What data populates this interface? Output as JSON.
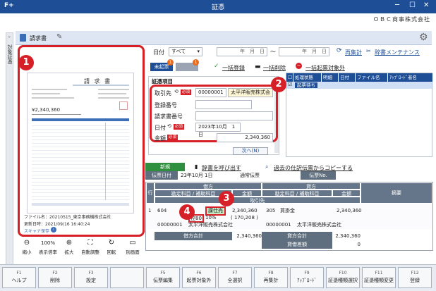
{
  "window": {
    "title": "証憑",
    "company": "ＯＢＣ商事株式会社",
    "app_icon_text": "F+"
  },
  "side_tab": "対象証憑",
  "doc_tab": {
    "label": "請求書"
  },
  "preview": {
    "invoice_title": "請 求 書",
    "invoice_amount": "¥2,340,360",
    "file_name": "ファイル名：20210515_東京事務機株式会社",
    "updated": "更新日時：2021/09/16 16:40:24",
    "scan_source": "スキャナ保存"
  },
  "zoom": {
    "value": "100%",
    "buttons": [
      "縮小",
      "表示倍率",
      "拡大",
      "自動調整",
      "回転",
      "別画面"
    ]
  },
  "filter": {
    "date_label": "日付",
    "date_range": "すべて",
    "date_placeholder": "年　月　日",
    "tilde": "～",
    "recalc": "再集計",
    "dict_maint": "辞書メンテナンス"
  },
  "status_tabs": {
    "unregistered": "未起票",
    "unregistered_count": "1",
    "other_count": "1",
    "bulk_register": "一括登録",
    "bulk_delete": "一括削除",
    "bulk_exclude": "一括起票対象外"
  },
  "voucher_items": {
    "heading": "証憑項目",
    "partner_label": "取引先",
    "partner_code": "00000001",
    "partner_name": "太平洋販売株式会",
    "reg_no_label": "登録番号",
    "invoice_no_label": "請求書番号",
    "date_label": "日付",
    "date_value": "2023年10月　1日",
    "amount_label": "金額",
    "amount_value": "2,340,360",
    "required": "必須",
    "next": "次へ(N)"
  },
  "grid": {
    "headers": [
      "処理状態",
      "明細",
      "日付",
      "ファイル名",
      "ｱｯﾌﾟﾛｰﾄﾞ者名"
    ],
    "row_status": "起票待ち"
  },
  "journal": {
    "new_label": "新規",
    "call_dict": "辞書を呼び出す",
    "copy_past": "過去の仕訳伝票からコピーする",
    "date_label": "伝票日付",
    "date_value": "23年10月 1日",
    "type": "通常伝票",
    "no_label": "伝票No.",
    "row_label": "行",
    "debit": "借方",
    "credit": "貸方",
    "account": "勘定科目 / 補助科目",
    "amount": "金額",
    "partner": "取引先",
    "memo": "摘要",
    "row_no": "1",
    "debit_code": "604",
    "tax_class": "課仕売",
    "debit_amount": "2,340,360",
    "debit_tax": "( 170,208 )",
    "credit_code": "305",
    "credit_name": "買掛金",
    "credit_amount": "2,340,360",
    "tax_rate_tag": "控80",
    "tax_rate": "10%",
    "partner_code": "00000001",
    "partner_name": "太平洋販売株式会社",
    "partner_code2": "00000001",
    "partner_name2": "太平洋販売株式会社",
    "debit_total_label": "借方合計",
    "debit_total": "2,340,360",
    "credit_total_label": "貸方合計",
    "credit_total": "2,340,360",
    "diff_label": "貸借差額",
    "diff_value": "0"
  },
  "callouts": [
    "1",
    "2",
    "3",
    "4"
  ],
  "fkeys": [
    {
      "n": "F1",
      "label": "ヘルプ"
    },
    {
      "n": "F2",
      "label": "削除"
    },
    {
      "n": "F3",
      "label": "設定"
    },
    {
      "n": "",
      "label": ""
    },
    {
      "n": "F5",
      "label": "伝票編集"
    },
    {
      "n": "F6",
      "label": "起票対象外"
    },
    {
      "n": "F7",
      "label": "全選択"
    },
    {
      "n": "F8",
      "label": "再集計"
    },
    {
      "n": "F9",
      "label": "ｱｯﾌﾟﾛｰﾄﾞ"
    },
    {
      "n": "F10",
      "label": "証憑種類選択"
    },
    {
      "n": "F11",
      "label": "証憑種類変更"
    },
    {
      "n": "F12",
      "label": "登録"
    }
  ]
}
